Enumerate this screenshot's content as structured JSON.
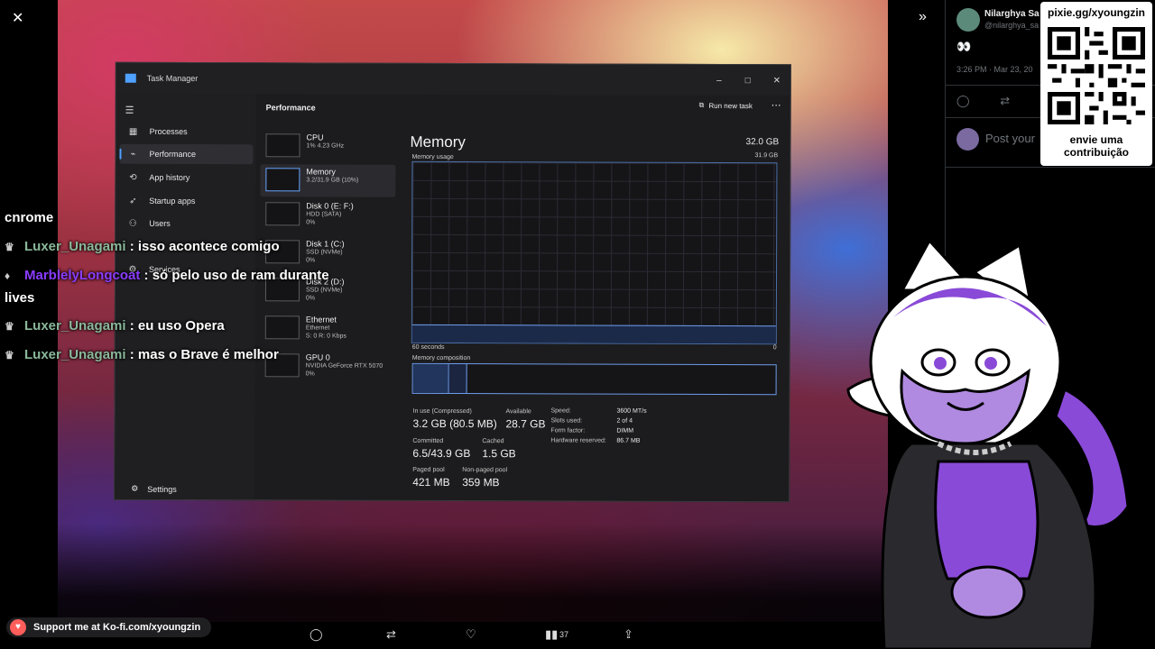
{
  "task_manager": {
    "title": "Task Manager",
    "page_heading": "Performance",
    "run_new_task": "Run new task",
    "nav": [
      {
        "label": "Processes",
        "icon": "processes-icon"
      },
      {
        "label": "Performance",
        "icon": "performance-icon",
        "active": true
      },
      {
        "label": "App history",
        "icon": "app-history-icon"
      },
      {
        "label": "Startup apps",
        "icon": "startup-apps-icon"
      },
      {
        "label": "Users",
        "icon": "users-icon"
      },
      {
        "label": "Services",
        "icon": "services-icon"
      }
    ],
    "settings": "Settings",
    "devices": [
      {
        "name": "CPU",
        "sub1": "1% 4.23 GHz",
        "sub2": ""
      },
      {
        "name": "Memory",
        "sub1": "3.2/31.9 GB (10%)",
        "sub2": ""
      },
      {
        "name": "Disk 0 (E: F:)",
        "sub1": "HDD (SATA)",
        "sub2": "0%"
      },
      {
        "name": "Disk 1 (C:)",
        "sub1": "SSD (NVMe)",
        "sub2": "0%"
      },
      {
        "name": "Disk 2 (D:)",
        "sub1": "SSD (NVMe)",
        "sub2": "0%"
      },
      {
        "name": "Ethernet",
        "sub1": "Ethernet",
        "sub2": "S: 0 R: 0 Kbps"
      },
      {
        "name": "GPU 0",
        "sub1": "NVIDIA GeForce RTX 5070",
        "sub2": "0%"
      }
    ],
    "memory": {
      "title": "Memory",
      "total": "32.0 GB",
      "usage_label": "Memory usage",
      "usage_max": "31.9 GB",
      "graph_window": "60 seconds",
      "graph_min": "0",
      "usage_fraction": 0.1,
      "composition_label": "Memory composition",
      "in_use_fraction": 0.1,
      "cached_fraction": 0.05,
      "stats": {
        "in_use_label": "In use (Compressed)",
        "in_use": "3.2 GB (80.5 MB)",
        "available_label": "Available",
        "available": "28.7 GB",
        "committed_label": "Committed",
        "committed": "6.5/43.9 GB",
        "cached_label": "Cached",
        "cached": "1.5 GB",
        "paged_label": "Paged pool",
        "paged": "421 MB",
        "nonpaged_label": "Non-paged pool",
        "nonpaged": "359 MB"
      },
      "details": [
        {
          "k": "Speed:",
          "v": "3600 MT/s"
        },
        {
          "k": "Slots used:",
          "v": "2 of 4"
        },
        {
          "k": "Form factor:",
          "v": "DIMM"
        },
        {
          "k": "Hardware reserved:",
          "v": "86.7 MB"
        }
      ]
    }
  },
  "chat": {
    "line0": "cnrome",
    "messages": [
      {
        "user": "Luxer_Unagami",
        "sep": " : ",
        "text": "isso acontece comigo",
        "color": "green"
      },
      {
        "user": "MarblelyLongcoat",
        "sep": " : ",
        "text": "só pelo uso de ram durante",
        "color": "purple"
      },
      {
        "user": "Luxer_Unagami",
        "sep": " : ",
        "text": "eu uso Opera",
        "color": "green"
      },
      {
        "user": "Luxer_Unagami",
        "sep": " : ",
        "text": "mas o Brave é melhor",
        "color": "green"
      }
    ],
    "wrap": "lives"
  },
  "tweet": {
    "name": "Nilarghya Sa",
    "handle": "@nilarghya_sa",
    "body": "👀",
    "time": "3:26 PM · Mar 23, 20",
    "reply_placeholder": "Post your"
  },
  "qr_card": {
    "url": "pixie.gg/xyoungzin",
    "caption_line1": "envie uma",
    "caption_line2": "contribuição"
  },
  "kofi": {
    "label": "Support me at Ko-fi.com/xyoungzin"
  },
  "bottom_actions": {
    "views": "37"
  },
  "colors": {
    "accent": "#4ea1ff",
    "graph_line": "#6f9cea",
    "chat_green": "#8ab89a",
    "chat_purple": "#8a3cff"
  }
}
